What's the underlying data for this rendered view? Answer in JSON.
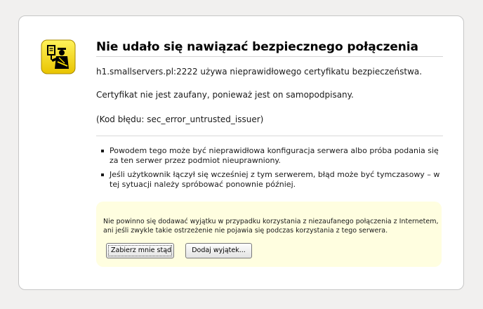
{
  "error": {
    "title": "Nie udało się nawiązać bezpiecznego połączenia",
    "line1": "h1.smallservers.pl:2222 używa nieprawidłowego certyfikatu bezpieczeństwa.",
    "line2": "Certyfikat nie jest zaufany, ponieważ jest on samopodpisany.",
    "line3": "(Kod błędu: sec_error_untrusted_issuer)",
    "bullets": [
      "Powodem tego może być nieprawidłowa konfiguracja serwera albo próba podania się za ten serwer przez podmiot nieuprawniony.",
      "Jeśli użytkownik łączył się wcześniej z tym serwerem, błąd może być tymczasowy – w tej sytuacji należy spróbować ponownie później."
    ]
  },
  "warning": {
    "text": "Nie powinno się dodawać wyjątku w przypadku korzystania z niezaufanego połączenia z Internetem, ani jeśli zwykle takie ostrzeżenie nie pojawia się podczas korzystania z tego serwera.",
    "get_me_out_label": "Zabierz mnie stąd",
    "add_exception_label": "Dodaj wyjątek..."
  },
  "icon": "security-officer-icon",
  "colors": {
    "background": "#f1f0ef",
    "panel": "#ffffff",
    "warning_panel": "#fffee0",
    "icon_yellow": "#f5d800"
  }
}
